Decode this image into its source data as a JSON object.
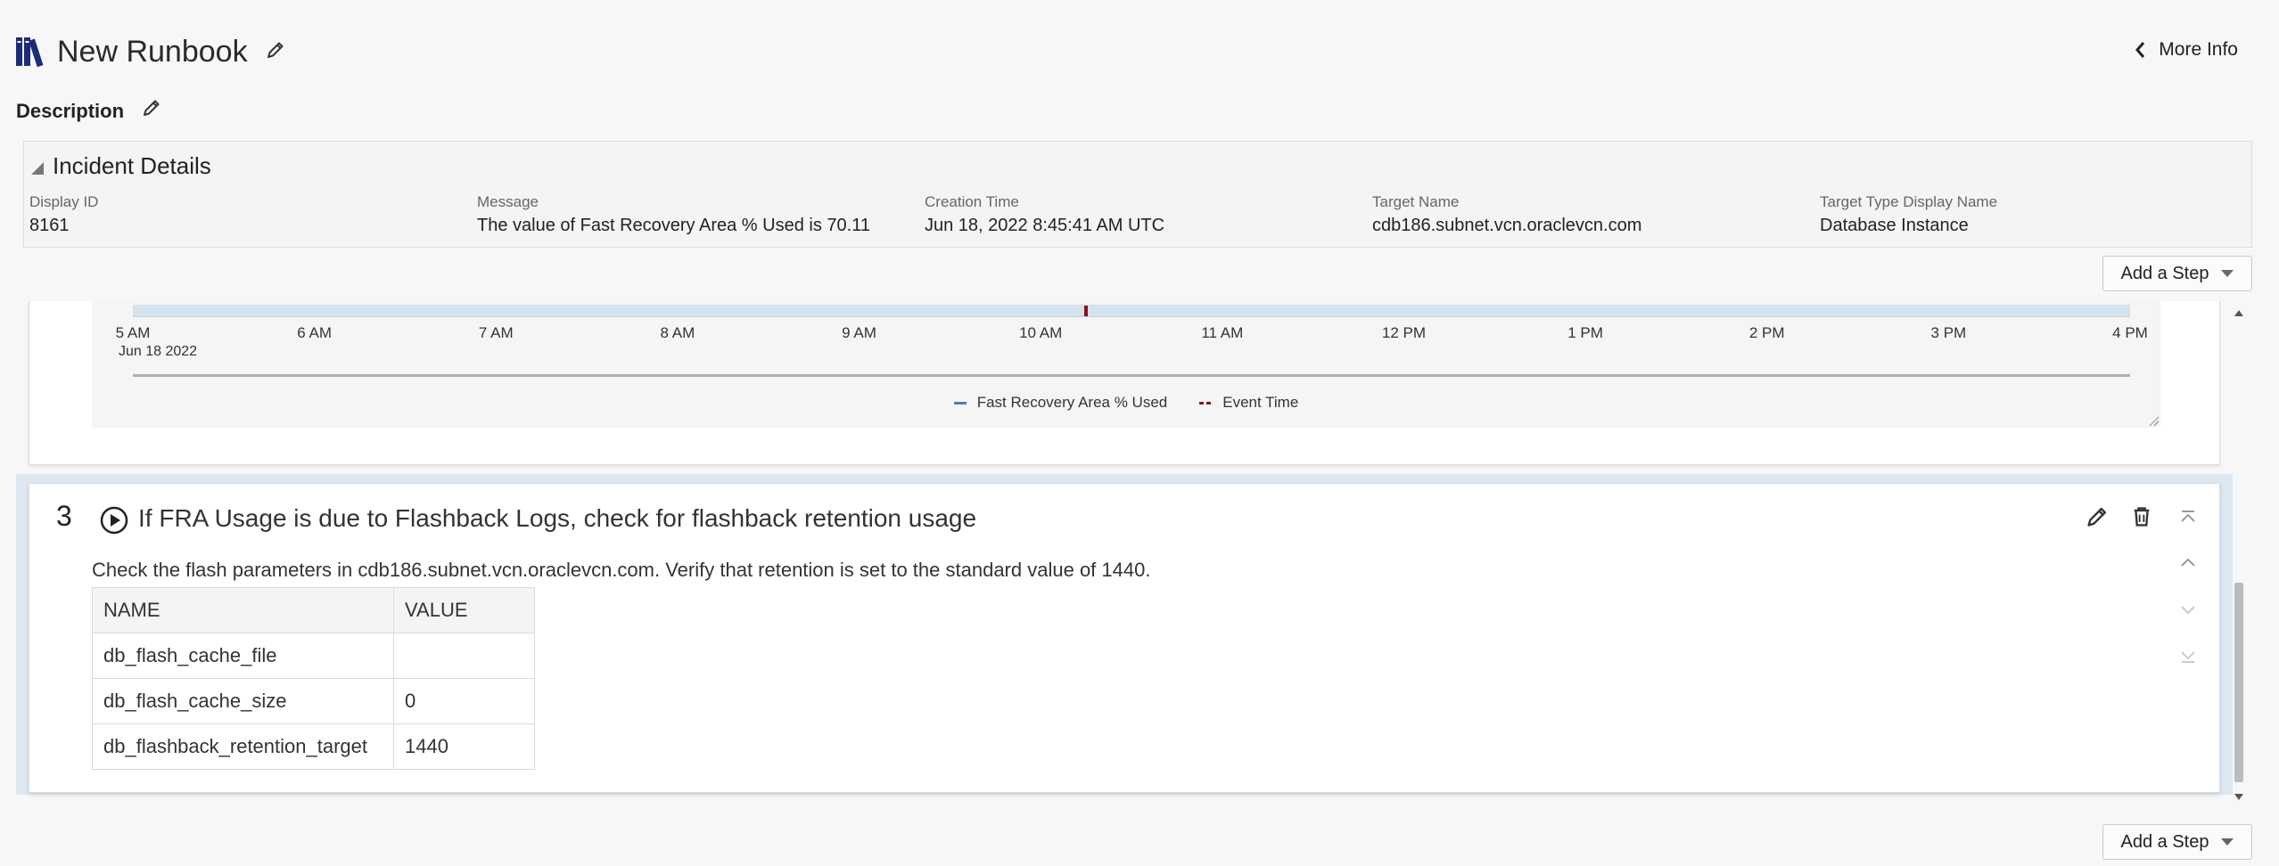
{
  "header": {
    "title": "New Runbook",
    "more_info": "More Info",
    "description_label": "Description"
  },
  "incident": {
    "section_title": "Incident Details",
    "fields": [
      {
        "label": "Display ID",
        "value": "8161"
      },
      {
        "label": "Message",
        "value": "The value of Fast Recovery Area % Used is 70.11"
      },
      {
        "label": "Creation Time",
        "value": "Jun 18, 2022 8:45:41 AM UTC"
      },
      {
        "label": "Target Name",
        "value": "cdb186.subnet.vcn.oraclevcn.com"
      },
      {
        "label": "Target Type Display Name",
        "value": "Database Instance"
      }
    ]
  },
  "add_step_label": "Add a Step",
  "chart": {
    "ticks": [
      "5 AM",
      "6 AM",
      "7 AM",
      "8 AM",
      "9 AM",
      "10 AM",
      "11 AM",
      "12 PM",
      "1 PM",
      "2 PM",
      "3 PM",
      "4 PM"
    ],
    "date_label": "Jun 18 2022",
    "legend": [
      "Fast Recovery Area % Used",
      "Event Time"
    ],
    "event_time_hours_after_5am": 5.25,
    "series_color": "#3b85c5",
    "event_color": "#8b1414"
  },
  "step3": {
    "number": "3",
    "title": "If FRA Usage is due to Flashback Logs, check for flashback retention usage",
    "description": "Check the flash parameters in cdb186.subnet.vcn.oraclevcn.com. Verify that retention is set to the standard value of 1440.",
    "table": {
      "headers": [
        "NAME",
        "VALUE"
      ],
      "rows": [
        [
          "db_flash_cache_file",
          ""
        ],
        [
          "db_flash_cache_size",
          "0"
        ],
        [
          "db_flashback_retention_target",
          "1440"
        ]
      ]
    }
  },
  "icons": {
    "app": "runbook-books-icon",
    "edit": "pencil-icon",
    "back": "chevron-left-icon",
    "run": "play-circle-icon",
    "delete": "trash-icon",
    "move_top": "move-to-top-icon",
    "move_up": "chevron-up-icon",
    "move_down": "chevron-down-icon",
    "move_bottom": "move-to-bottom-icon"
  }
}
